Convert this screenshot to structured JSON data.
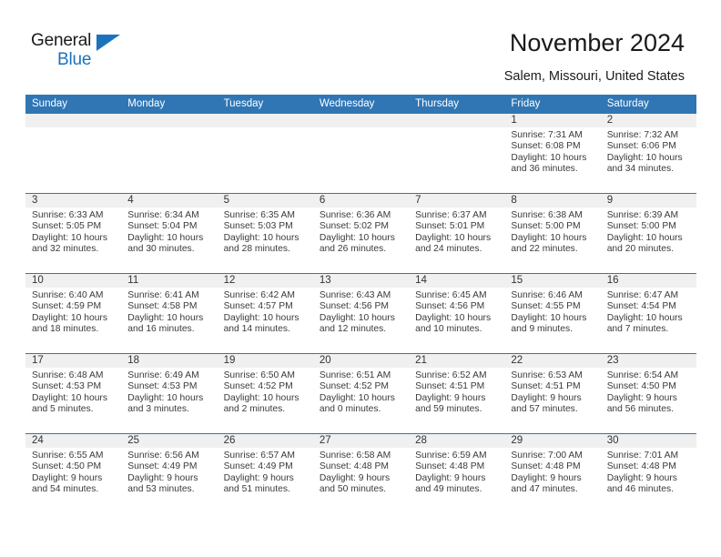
{
  "brand": {
    "name_top": "General",
    "name_bottom": "Blue",
    "accent_color": "#1b72bd"
  },
  "header": {
    "title": "November 2024",
    "subtitle": "Salem, Missouri, United States",
    "header_bg_color": "#3076b4",
    "daynum_bg_color": "#f0f0f0"
  },
  "weekday_headers": [
    "Sunday",
    "Monday",
    "Tuesday",
    "Wednesday",
    "Thursday",
    "Friday",
    "Saturday"
  ],
  "labels": {
    "sunrise_prefix": "Sunrise:",
    "sunset_prefix": "Sunset:",
    "daylight_prefix": "Daylight:"
  },
  "weeks": [
    [
      {
        "day": "",
        "empty": true
      },
      {
        "day": "",
        "empty": true
      },
      {
        "day": "",
        "empty": true
      },
      {
        "day": "",
        "empty": true
      },
      {
        "day": "",
        "empty": true
      },
      {
        "day": "1",
        "sunrise": "Sunrise: 7:31 AM",
        "sunset": "Sunset: 6:08 PM",
        "daylight": "Daylight: 10 hours and 36 minutes."
      },
      {
        "day": "2",
        "sunrise": "Sunrise: 7:32 AM",
        "sunset": "Sunset: 6:06 PM",
        "daylight": "Daylight: 10 hours and 34 minutes."
      }
    ],
    [
      {
        "day": "3",
        "sunrise": "Sunrise: 6:33 AM",
        "sunset": "Sunset: 5:05 PM",
        "daylight": "Daylight: 10 hours and 32 minutes."
      },
      {
        "day": "4",
        "sunrise": "Sunrise: 6:34 AM",
        "sunset": "Sunset: 5:04 PM",
        "daylight": "Daylight: 10 hours and 30 minutes."
      },
      {
        "day": "5",
        "sunrise": "Sunrise: 6:35 AM",
        "sunset": "Sunset: 5:03 PM",
        "daylight": "Daylight: 10 hours and 28 minutes."
      },
      {
        "day": "6",
        "sunrise": "Sunrise: 6:36 AM",
        "sunset": "Sunset: 5:02 PM",
        "daylight": "Daylight: 10 hours and 26 minutes."
      },
      {
        "day": "7",
        "sunrise": "Sunrise: 6:37 AM",
        "sunset": "Sunset: 5:01 PM",
        "daylight": "Daylight: 10 hours and 24 minutes."
      },
      {
        "day": "8",
        "sunrise": "Sunrise: 6:38 AM",
        "sunset": "Sunset: 5:00 PM",
        "daylight": "Daylight: 10 hours and 22 minutes."
      },
      {
        "day": "9",
        "sunrise": "Sunrise: 6:39 AM",
        "sunset": "Sunset: 5:00 PM",
        "daylight": "Daylight: 10 hours and 20 minutes."
      }
    ],
    [
      {
        "day": "10",
        "sunrise": "Sunrise: 6:40 AM",
        "sunset": "Sunset: 4:59 PM",
        "daylight": "Daylight: 10 hours and 18 minutes."
      },
      {
        "day": "11",
        "sunrise": "Sunrise: 6:41 AM",
        "sunset": "Sunset: 4:58 PM",
        "daylight": "Daylight: 10 hours and 16 minutes."
      },
      {
        "day": "12",
        "sunrise": "Sunrise: 6:42 AM",
        "sunset": "Sunset: 4:57 PM",
        "daylight": "Daylight: 10 hours and 14 minutes."
      },
      {
        "day": "13",
        "sunrise": "Sunrise: 6:43 AM",
        "sunset": "Sunset: 4:56 PM",
        "daylight": "Daylight: 10 hours and 12 minutes."
      },
      {
        "day": "14",
        "sunrise": "Sunrise: 6:45 AM",
        "sunset": "Sunset: 4:56 PM",
        "daylight": "Daylight: 10 hours and 10 minutes."
      },
      {
        "day": "15",
        "sunrise": "Sunrise: 6:46 AM",
        "sunset": "Sunset: 4:55 PM",
        "daylight": "Daylight: 10 hours and 9 minutes."
      },
      {
        "day": "16",
        "sunrise": "Sunrise: 6:47 AM",
        "sunset": "Sunset: 4:54 PM",
        "daylight": "Daylight: 10 hours and 7 minutes."
      }
    ],
    [
      {
        "day": "17",
        "sunrise": "Sunrise: 6:48 AM",
        "sunset": "Sunset: 4:53 PM",
        "daylight": "Daylight: 10 hours and 5 minutes."
      },
      {
        "day": "18",
        "sunrise": "Sunrise: 6:49 AM",
        "sunset": "Sunset: 4:53 PM",
        "daylight": "Daylight: 10 hours and 3 minutes."
      },
      {
        "day": "19",
        "sunrise": "Sunrise: 6:50 AM",
        "sunset": "Sunset: 4:52 PM",
        "daylight": "Daylight: 10 hours and 2 minutes."
      },
      {
        "day": "20",
        "sunrise": "Sunrise: 6:51 AM",
        "sunset": "Sunset: 4:52 PM",
        "daylight": "Daylight: 10 hours and 0 minutes."
      },
      {
        "day": "21",
        "sunrise": "Sunrise: 6:52 AM",
        "sunset": "Sunset: 4:51 PM",
        "daylight": "Daylight: 9 hours and 59 minutes."
      },
      {
        "day": "22",
        "sunrise": "Sunrise: 6:53 AM",
        "sunset": "Sunset: 4:51 PM",
        "daylight": "Daylight: 9 hours and 57 minutes."
      },
      {
        "day": "23",
        "sunrise": "Sunrise: 6:54 AM",
        "sunset": "Sunset: 4:50 PM",
        "daylight": "Daylight: 9 hours and 56 minutes."
      }
    ],
    [
      {
        "day": "24",
        "sunrise": "Sunrise: 6:55 AM",
        "sunset": "Sunset: 4:50 PM",
        "daylight": "Daylight: 9 hours and 54 minutes."
      },
      {
        "day": "25",
        "sunrise": "Sunrise: 6:56 AM",
        "sunset": "Sunset: 4:49 PM",
        "daylight": "Daylight: 9 hours and 53 minutes."
      },
      {
        "day": "26",
        "sunrise": "Sunrise: 6:57 AM",
        "sunset": "Sunset: 4:49 PM",
        "daylight": "Daylight: 9 hours and 51 minutes."
      },
      {
        "day": "27",
        "sunrise": "Sunrise: 6:58 AM",
        "sunset": "Sunset: 4:48 PM",
        "daylight": "Daylight: 9 hours and 50 minutes."
      },
      {
        "day": "28",
        "sunrise": "Sunrise: 6:59 AM",
        "sunset": "Sunset: 4:48 PM",
        "daylight": "Daylight: 9 hours and 49 minutes."
      },
      {
        "day": "29",
        "sunrise": "Sunrise: 7:00 AM",
        "sunset": "Sunset: 4:48 PM",
        "daylight": "Daylight: 9 hours and 47 minutes."
      },
      {
        "day": "30",
        "sunrise": "Sunrise: 7:01 AM",
        "sunset": "Sunset: 4:48 PM",
        "daylight": "Daylight: 9 hours and 46 minutes."
      }
    ]
  ]
}
